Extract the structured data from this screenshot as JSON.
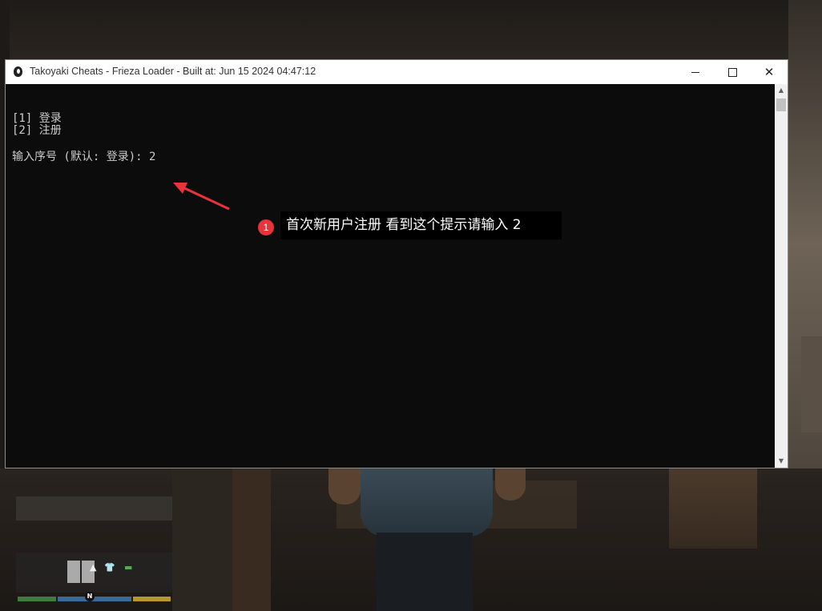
{
  "window": {
    "title": "Takoyaki Cheats - Frieza Loader - Built at:  Jun 15 2024 04:47:12",
    "icon": "app-icon",
    "minimize_icon": "minimize-icon",
    "maximize_icon": "maximize-icon",
    "close_icon": "close-icon",
    "close_glyph": "✕"
  },
  "console": {
    "lines": [
      "[1] 登录",
      "[2] 注册",
      "输入序号 (默认: 登录): 2"
    ],
    "background": "#0c0c0c",
    "text_color": "#cccccc"
  },
  "annotation": {
    "badge": "1",
    "text": "首次新用户注册 看到这个提示请输入  2",
    "badge_color": "#e8333a",
    "arrow_color": "#e8333a"
  },
  "hud": {
    "north_label": "N"
  }
}
